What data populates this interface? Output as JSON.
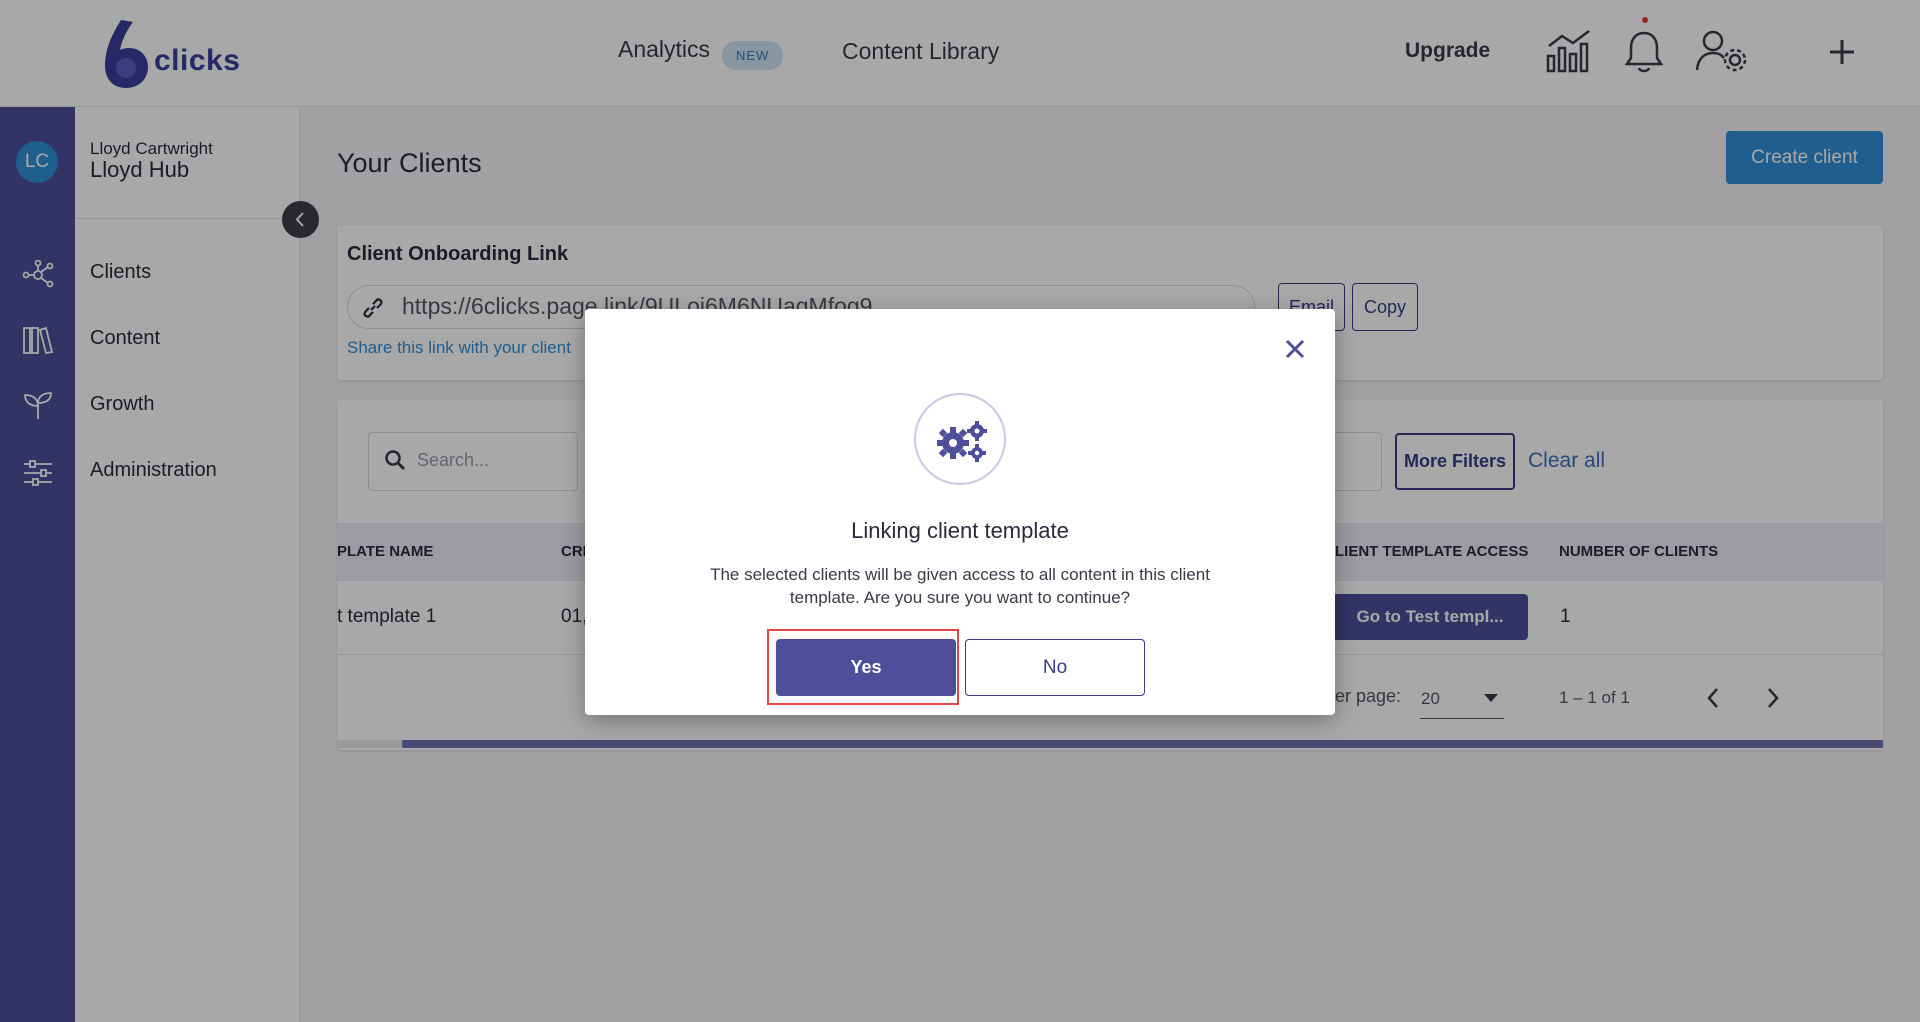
{
  "topbar": {
    "logo_text": "clicks",
    "nav": {
      "analytics": "Analytics",
      "badge_new": "NEW",
      "content_library": "Content Library"
    },
    "upgrade": "Upgrade",
    "icons": [
      "chart-icon",
      "bell-icon",
      "user-settings-icon",
      "plus-icon"
    ]
  },
  "sidebar": {
    "avatar_initials": "LC",
    "user_name": "Lloyd Cartwright",
    "hub_name": "Lloyd Hub",
    "items": [
      {
        "label": "Clients",
        "icon": "network-icon"
      },
      {
        "label": "Content",
        "icon": "library-icon"
      },
      {
        "label": "Growth",
        "icon": "sprout-icon"
      },
      {
        "label": "Administration",
        "icon": "sliders-icon"
      }
    ]
  },
  "main": {
    "title": "Your Clients",
    "create_button": "Create client",
    "onboarding": {
      "title": "Client Onboarding Link",
      "link": "https://6clicks.page.link/9ULoi6M6NUagMfog9",
      "email_button": "Email",
      "copy_button": "Copy",
      "share_text": "Share this link with your client"
    },
    "filters": {
      "search_placeholder": "Search...",
      "more_filters": "More Filters",
      "clear_all": "Clear all"
    },
    "table": {
      "headers": [
        "PLATE NAME",
        "CRE",
        "LIENT TEMPLATE ACCESS",
        "NUMBER OF CLIENTS"
      ],
      "rows": [
        {
          "name": "t template 1",
          "created": "01,",
          "access_button": "Go to Test templ...",
          "count": "1"
        }
      ]
    },
    "pagination": {
      "per_page_label": "per page:",
      "per_page_value": "20",
      "range": "1 – 1 of 1"
    }
  },
  "modal": {
    "title": "Linking client template",
    "body": "The selected clients will be given access to all content in this client template. Are you sure you want to continue?",
    "yes": "Yes",
    "no": "No"
  },
  "colors": {
    "accent": "#4e4e9a",
    "primary_blue": "#2f8fd8",
    "highlight": "#e04848"
  }
}
